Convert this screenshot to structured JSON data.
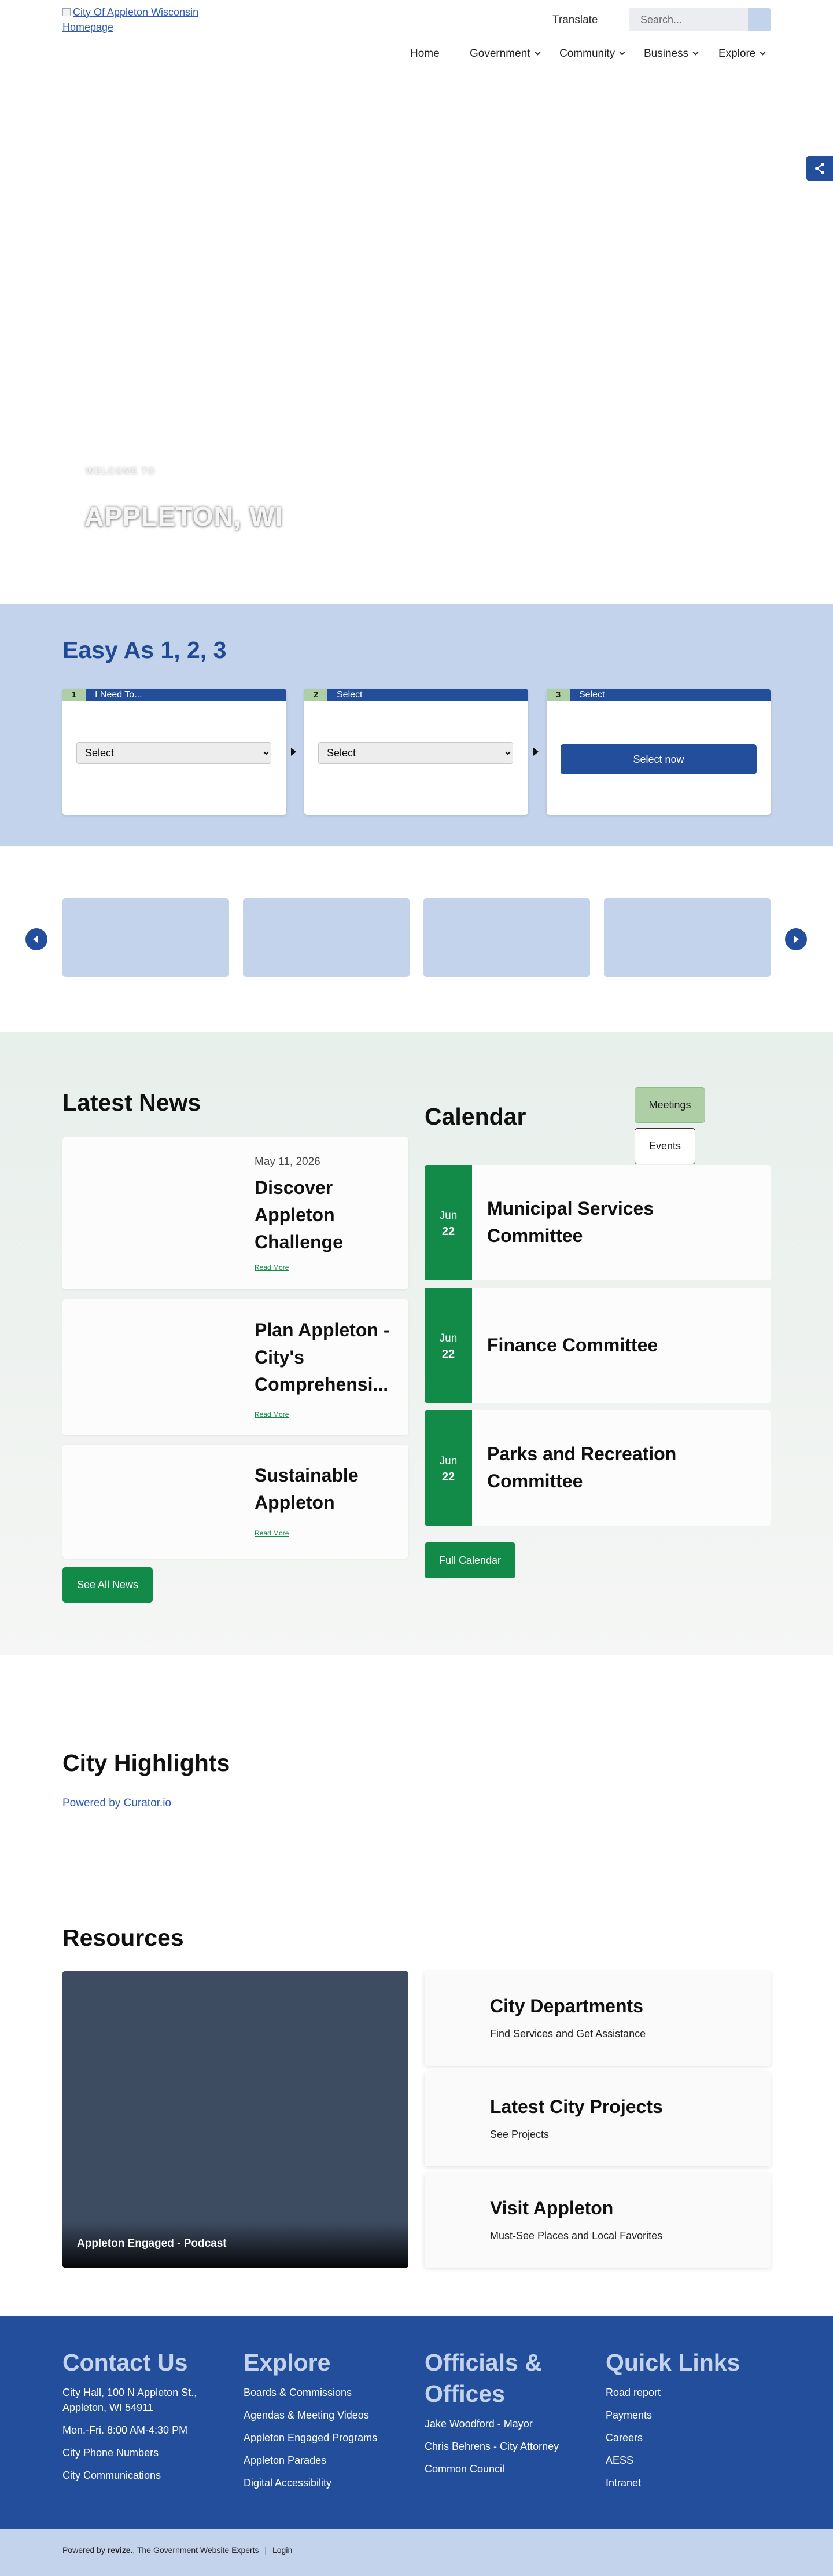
{
  "header": {
    "logo_alt": "City Of Appleton Wisconsin Homepage",
    "translate": "Translate",
    "search_placeholder": "Search...",
    "nav": [
      {
        "label": "Home"
      },
      {
        "label": "Government"
      },
      {
        "label": "Community"
      },
      {
        "label": "Business"
      },
      {
        "label": "Explore"
      }
    ]
  },
  "hero": {
    "welcome": "WELCOME TO",
    "title": "APPLETON, WI"
  },
  "easy": {
    "title": "Easy As 1, 2, 3",
    "steps": [
      {
        "num": "1",
        "label": "I Need To...",
        "select": "Select"
      },
      {
        "num": "2",
        "label": "Select",
        "select": "Select"
      },
      {
        "num": "3",
        "label": "Select",
        "button": "Select now"
      }
    ]
  },
  "news": {
    "title": "Latest News",
    "items": [
      {
        "date": "May 11, 2026",
        "title": "Discover Appleton Challenge",
        "more": "Read More"
      },
      {
        "date": "",
        "title": "Plan Appleton - City's Comprehensi...",
        "more": "Read More"
      },
      {
        "date": "",
        "title": "Sustainable Appleton",
        "more": "Read More"
      }
    ],
    "see_all": "See All News"
  },
  "calendar": {
    "title": "Calendar",
    "tab_meetings": "Meetings",
    "tab_events": "Events",
    "events": [
      {
        "month": "Jun",
        "day": "22",
        "title": "Municipal Services Committee"
      },
      {
        "month": "Jun",
        "day": "22",
        "title": "Finance Committee"
      },
      {
        "month": "Jun",
        "day": "22",
        "title": "Parks and Recreation Committee"
      }
    ],
    "full_calendar": "Full Calendar"
  },
  "highlights": {
    "title": "City Highlights",
    "powered": "Powered by Curator.io"
  },
  "resources": {
    "title": "Resources",
    "podcast": "Appleton Engaged - Podcast",
    "cards": [
      {
        "title": "City Departments",
        "subtitle": "Find Services and Get Assistance"
      },
      {
        "title": "Latest City Projects",
        "subtitle": "See Projects"
      },
      {
        "title": "Visit Appleton",
        "subtitle": "Must-See Places and Local Favorites"
      }
    ]
  },
  "footer": {
    "contact": {
      "title": "Contact Us",
      "lines": [
        "City Hall, 100 N Appleton St.,",
        "Appleton, WI 54911",
        "Mon.-Fri. 8:00 AM-4:30 PM",
        "City Phone Numbers",
        "City Communications"
      ]
    },
    "explore": {
      "title": "Explore",
      "links": [
        "Boards & Commissions",
        "Agendas & Meeting Videos",
        "Appleton Engaged Programs",
        "Appleton Parades",
        "Digital Accessibility"
      ]
    },
    "officials": {
      "title": "Officials & Offices",
      "links": [
        "Jake Woodford - Mayor",
        "Chris Behrens - City Attorney",
        "Common Council"
      ]
    },
    "quick": {
      "title": "Quick Links",
      "links": [
        "Road report",
        "Payments",
        "Careers",
        "AESS",
        "Intranet"
      ]
    },
    "powered_prefix": "Powered by",
    "powered_brand": "revize.",
    "powered_suffix": "The Government Website Experts",
    "login": "Login"
  },
  "colors": {
    "navy": "#234e9c",
    "light_blue": "#c4d3ec",
    "green": "#128a48",
    "light_green": "#aecfa6"
  }
}
